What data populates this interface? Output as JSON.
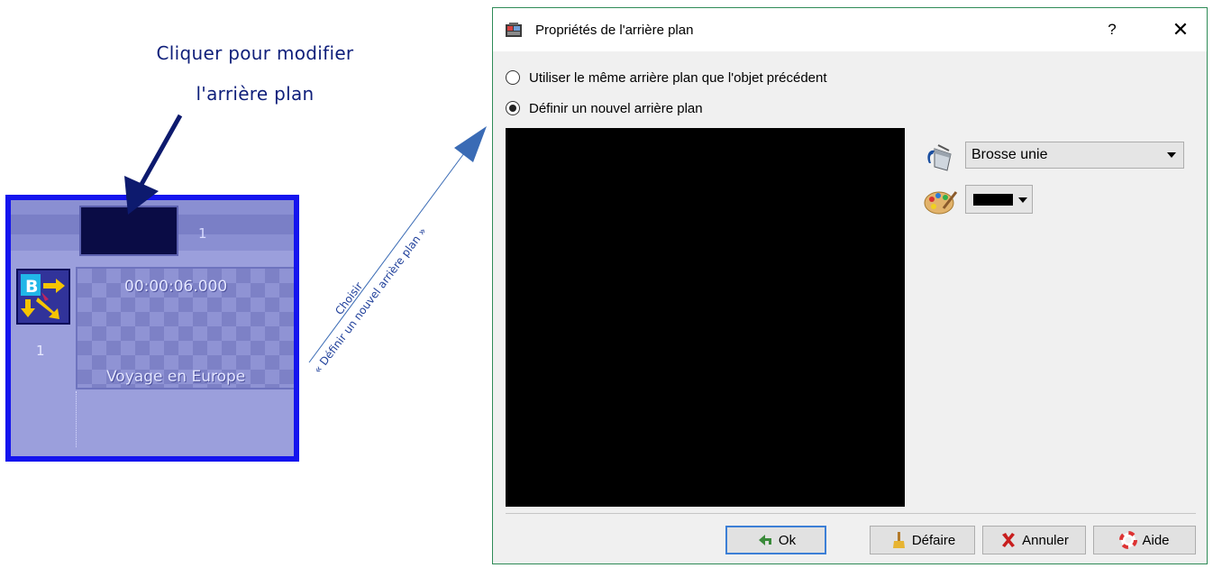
{
  "annotation": {
    "line1": "Cliquer pour modifier",
    "line2": "l'arrière plan",
    "arrow_caption_top": "Choisir",
    "arrow_caption_bottom": "« Définir un nouvel arrière plan »"
  },
  "timeline": {
    "top_number": "1",
    "side_number": "1",
    "clip_time": "00:00:06.000",
    "clip_title": "Voyage en Europe"
  },
  "dialog": {
    "title": "Propriétés de l'arrière plan",
    "help_label": "?",
    "close_label": "✕",
    "radio_same": "Utiliser le même arrière plan que l'objet précédent",
    "radio_new": "Définir un nouvel arrière plan",
    "selected_radio": "new",
    "brush_type": "Brosse unie",
    "color_value": "#000000",
    "buttons": {
      "ok": "Ok",
      "undo": "Défaire",
      "cancel": "Annuler",
      "help": "Aide"
    }
  },
  "colors": {
    "annotation_text": "#0f1f7a",
    "arrow_dark": "#0d1a6e",
    "arrow_light": "#3a6bb5",
    "timeline_border": "#1414ee",
    "dialog_border": "#2e8b57",
    "preview_background": "#000000"
  },
  "icons": [
    "brush-bucket-icon",
    "palette-icon",
    "undo-arrow-icon",
    "broom-icon",
    "red-x-icon",
    "lifebuoy-icon",
    "app-icon"
  ]
}
